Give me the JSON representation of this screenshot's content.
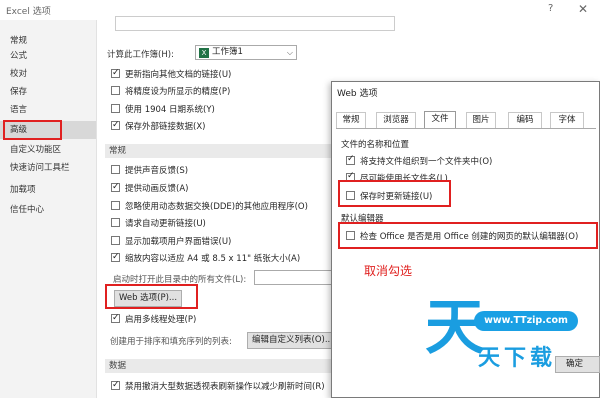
{
  "window": {
    "title": "Excel 选项",
    "help": "?",
    "close": "✕"
  },
  "sidebar": {
    "items": [
      {
        "label": "常规"
      },
      {
        "label": "公式"
      },
      {
        "label": "校对"
      },
      {
        "label": "保存"
      },
      {
        "label": "语言"
      },
      {
        "label": "高级"
      },
      {
        "label": "自定义功能区"
      },
      {
        "label": "快速访问工具栏"
      },
      {
        "label": "加载项"
      },
      {
        "label": "信任中心"
      }
    ],
    "selected": "高级"
  },
  "main": {
    "calc_label": "计算此工作簿(H):",
    "workbook_name": "工作簿1",
    "calc_options": [
      {
        "label": "更新指向其他文档的链接(U)",
        "checked": true
      },
      {
        "label": "将精度设为所显示的精度(P)",
        "checked": false
      },
      {
        "label": "使用 1904 日期系统(Y)",
        "checked": false
      },
      {
        "label": "保存外部链接数据(X)",
        "checked": true
      }
    ],
    "general_section": "常规",
    "general_options": [
      {
        "label": "提供声音反馈(S)",
        "checked": false
      },
      {
        "label": "提供动画反馈(A)",
        "checked": true
      },
      {
        "label": "忽略使用动态数据交换(DDE)的其他应用程序(O)",
        "checked": false
      },
      {
        "label": "请求自动更新链接(U)",
        "checked": false
      },
      {
        "label": "显示加载项用户界面错误(U)",
        "checked": false
      },
      {
        "label": "缩放内容以适应 A4 或 8.5 x 11\" 纸张大小(A)",
        "checked": true
      }
    ],
    "startup_label": "启动时打开此目录中的所有文件(L):",
    "web_button": "Web 选项(P)...",
    "multithread_label": "启用多线程处理(P)",
    "multithread_checked": true,
    "sort_label": "创建用于排序和填充序列的列表:",
    "custom_list_button": "编辑自定义列表(O)...",
    "data_section": "数据",
    "data_option": "禁用撤消大型数据透视表刷新操作以减少刷新时间(R)",
    "data_option_checked": true
  },
  "web_dialog": {
    "title": "Web 选项",
    "tabs": [
      "常规",
      "浏览器",
      "文件",
      "图片",
      "编码",
      "字体"
    ],
    "active_tab": "文件",
    "group1": "文件的名称和位置",
    "options": [
      {
        "label": "将支持文件组织到一个文件夹中(O)",
        "checked": true
      },
      {
        "label": "尽可能使用长文件名(L)",
        "checked": true
      },
      {
        "label": "保存时更新链接(U)",
        "checked": false
      }
    ],
    "group2": "默认编辑器",
    "editor_option": {
      "label": "检查 Office 是否是用 Office 创建的网页的默认编辑器(O)",
      "checked": false
    },
    "ok_button": "确定"
  },
  "annotation": {
    "note": "取消勾选"
  },
  "watermark": {
    "glyph": "天",
    "url": "www.TTzip.com",
    "text": "天下载"
  },
  "colors": {
    "annotation_red": "#e02020",
    "watermark_blue": "#1a9de0",
    "excel_green": "#207245"
  }
}
